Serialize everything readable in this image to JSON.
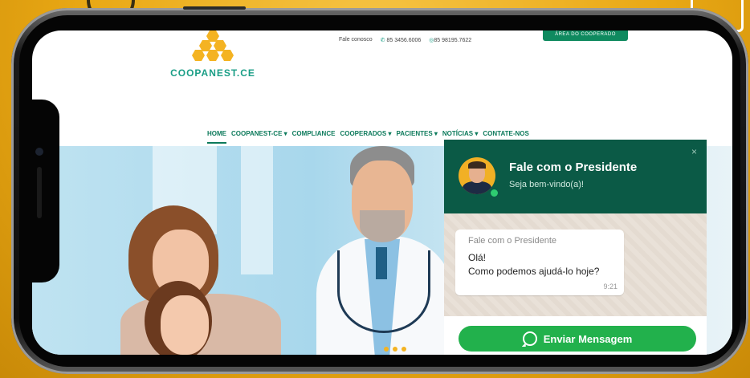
{
  "site": {
    "logo_text": "COOPANEST.CE",
    "contact": {
      "label": "Fale conosco",
      "phone": "85 3456.6006",
      "whatsapp": "85 98195.7622"
    },
    "area_button": "ÁREA DO COOPERADO",
    "nav": [
      {
        "label": "HOME"
      },
      {
        "label": "COOPANEST-CE ▾"
      },
      {
        "label": "COMPLIANCE"
      },
      {
        "label": "COOPERADOS ▾"
      },
      {
        "label": "PACIENTES ▾"
      },
      {
        "label": "NOTÍCIAS ▾"
      },
      {
        "label": "CONTATE-NOS"
      }
    ]
  },
  "chat": {
    "title": "Fale com o Presidente",
    "subtitle": "Seja bem-vindo(a)!",
    "close": "×",
    "message": {
      "sender": "Fale com o Presidente",
      "line1": "Olá!",
      "line2": "Como podemos ajudá-lo hoje?",
      "time": "9:21"
    },
    "send_label": "Enviar Mensagem"
  },
  "colors": {
    "brand_green": "#0c7a5b",
    "chat_header": "#0b5a46",
    "send_button": "#22b14c",
    "honeycomb": "#f4b322",
    "background": "#f2b21f"
  }
}
